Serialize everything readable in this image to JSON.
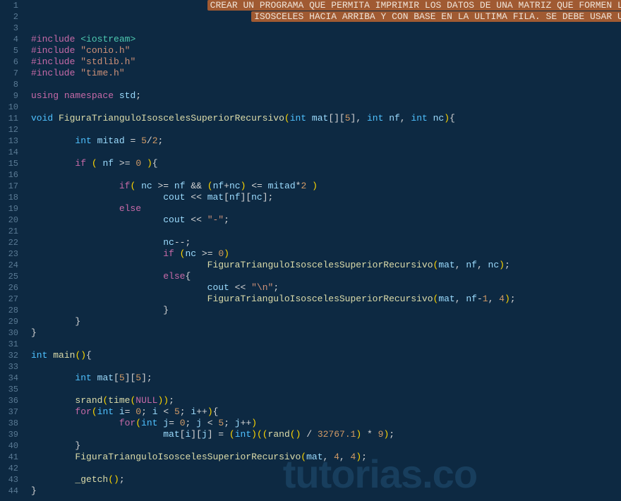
{
  "watermark": "tutorias.co",
  "gutter": {
    "start": 1,
    "end": 44
  },
  "lines": [
    {
      "indent": 8,
      "tokens": [
        {
          "cls": "comment-banner",
          "t": "CREAR UN PROGRAMA QUE PERMITA IMPRIMIR LOS DATOS DE UNA MATRIZ QUE FORMEN LA FIGURA TRIANGULO"
        }
      ],
      "ws": true
    },
    {
      "indent": 10,
      "tokens": [
        {
          "cls": "comment-banner",
          "t": "ISOSCELES HACIA ARRIBA Y CON BASE EN LA ULTIMA FILA. SE DEBE USAR UNA FUNCION RECURSIVA"
        }
      ],
      "ws": true
    },
    {
      "blank": true
    },
    {
      "tokens": [
        {
          "cls": "pp",
          "t": "#include"
        },
        {
          "cls": "plain",
          "t": " "
        },
        {
          "cls": "inc",
          "t": "<iostream>"
        }
      ]
    },
    {
      "tokens": [
        {
          "cls": "pp",
          "t": "#include"
        },
        {
          "cls": "plain",
          "t": " "
        },
        {
          "cls": "str",
          "t": "\"conio.h\""
        }
      ]
    },
    {
      "tokens": [
        {
          "cls": "pp",
          "t": "#include"
        },
        {
          "cls": "plain",
          "t": " "
        },
        {
          "cls": "str",
          "t": "\"stdlib.h\""
        }
      ]
    },
    {
      "tokens": [
        {
          "cls": "pp",
          "t": "#include"
        },
        {
          "cls": "plain",
          "t": " "
        },
        {
          "cls": "str",
          "t": "\"time.h\""
        }
      ]
    },
    {
      "blank": true
    },
    {
      "tokens": [
        {
          "cls": "key",
          "t": "using"
        },
        {
          "cls": "plain",
          "t": " "
        },
        {
          "cls": "key",
          "t": "namespace"
        },
        {
          "cls": "plain",
          "t": " "
        },
        {
          "cls": "ident",
          "t": "std"
        },
        {
          "cls": "punc",
          "t": ";"
        }
      ]
    },
    {
      "blank": true
    },
    {
      "tokens": [
        {
          "cls": "type",
          "t": "void"
        },
        {
          "cls": "plain",
          "t": " "
        },
        {
          "cls": "func",
          "t": "FiguraTrianguloIsoscelesSuperiorRecursivo"
        },
        {
          "cls": "paren",
          "t": "("
        },
        {
          "cls": "type",
          "t": "int"
        },
        {
          "cls": "plain",
          "t": " "
        },
        {
          "cls": "ident",
          "t": "mat"
        },
        {
          "cls": "punc",
          "t": "[]["
        },
        {
          "cls": "num",
          "t": "5"
        },
        {
          "cls": "punc",
          "t": "]"
        },
        {
          "cls": "punc",
          "t": ", "
        },
        {
          "cls": "type",
          "t": "int"
        },
        {
          "cls": "plain",
          "t": " "
        },
        {
          "cls": "ident",
          "t": "nf"
        },
        {
          "cls": "punc",
          "t": ", "
        },
        {
          "cls": "type",
          "t": "int"
        },
        {
          "cls": "plain",
          "t": " "
        },
        {
          "cls": "ident",
          "t": "nc"
        },
        {
          "cls": "paren",
          "t": ")"
        },
        {
          "cls": "punc",
          "t": "{"
        }
      ]
    },
    {
      "blank": true
    },
    {
      "indent": 2,
      "tokens": [
        {
          "cls": "type",
          "t": "int"
        },
        {
          "cls": "plain",
          "t": " "
        },
        {
          "cls": "ident",
          "t": "mitad"
        },
        {
          "cls": "plain",
          "t": " "
        },
        {
          "cls": "op",
          "t": "="
        },
        {
          "cls": "plain",
          "t": " "
        },
        {
          "cls": "num",
          "t": "5"
        },
        {
          "cls": "op",
          "t": "/"
        },
        {
          "cls": "num",
          "t": "2"
        },
        {
          "cls": "punc",
          "t": ";"
        }
      ]
    },
    {
      "blank": true
    },
    {
      "indent": 2,
      "tokens": [
        {
          "cls": "key",
          "t": "if"
        },
        {
          "cls": "plain",
          "t": " "
        },
        {
          "cls": "paren",
          "t": "("
        },
        {
          "cls": "plain",
          "t": " "
        },
        {
          "cls": "ident",
          "t": "nf"
        },
        {
          "cls": "plain",
          "t": " "
        },
        {
          "cls": "op",
          "t": ">="
        },
        {
          "cls": "plain",
          "t": " "
        },
        {
          "cls": "num",
          "t": "0"
        },
        {
          "cls": "plain",
          "t": " "
        },
        {
          "cls": "paren",
          "t": ")"
        },
        {
          "cls": "punc",
          "t": "{"
        }
      ]
    },
    {
      "blank": true
    },
    {
      "indent": 4,
      "tokens": [
        {
          "cls": "key",
          "t": "if"
        },
        {
          "cls": "paren",
          "t": "("
        },
        {
          "cls": "plain",
          "t": " "
        },
        {
          "cls": "ident",
          "t": "nc"
        },
        {
          "cls": "plain",
          "t": " "
        },
        {
          "cls": "op",
          "t": ">="
        },
        {
          "cls": "plain",
          "t": " "
        },
        {
          "cls": "ident",
          "t": "nf"
        },
        {
          "cls": "plain",
          "t": " "
        },
        {
          "cls": "op",
          "t": "&&"
        },
        {
          "cls": "plain",
          "t": " "
        },
        {
          "cls": "paren",
          "t": "("
        },
        {
          "cls": "ident",
          "t": "nf"
        },
        {
          "cls": "op",
          "t": "+"
        },
        {
          "cls": "ident",
          "t": "nc"
        },
        {
          "cls": "paren",
          "t": ")"
        },
        {
          "cls": "plain",
          "t": " "
        },
        {
          "cls": "op",
          "t": "<="
        },
        {
          "cls": "plain",
          "t": " "
        },
        {
          "cls": "ident",
          "t": "mitad"
        },
        {
          "cls": "op",
          "t": "*"
        },
        {
          "cls": "num",
          "t": "2"
        },
        {
          "cls": "plain",
          "t": " "
        },
        {
          "cls": "paren",
          "t": ")"
        }
      ]
    },
    {
      "indent": 6,
      "tokens": [
        {
          "cls": "ident",
          "t": "cout"
        },
        {
          "cls": "plain",
          "t": " "
        },
        {
          "cls": "op",
          "t": "<<"
        },
        {
          "cls": "plain",
          "t": " "
        },
        {
          "cls": "ident",
          "t": "mat"
        },
        {
          "cls": "punc",
          "t": "["
        },
        {
          "cls": "ident",
          "t": "nf"
        },
        {
          "cls": "punc",
          "t": "]["
        },
        {
          "cls": "ident",
          "t": "nc"
        },
        {
          "cls": "punc",
          "t": "];"
        }
      ]
    },
    {
      "indent": 4,
      "tokens": [
        {
          "cls": "key",
          "t": "else"
        }
      ]
    },
    {
      "indent": 6,
      "tokens": [
        {
          "cls": "ident",
          "t": "cout"
        },
        {
          "cls": "plain",
          "t": " "
        },
        {
          "cls": "op",
          "t": "<<"
        },
        {
          "cls": "plain",
          "t": " "
        },
        {
          "cls": "str",
          "t": "\"-\""
        },
        {
          "cls": "punc",
          "t": ";"
        }
      ]
    },
    {
      "blank": true
    },
    {
      "indent": 6,
      "tokens": [
        {
          "cls": "ident",
          "t": "nc"
        },
        {
          "cls": "op",
          "t": "--"
        },
        {
          "cls": "punc",
          "t": ";"
        }
      ]
    },
    {
      "indent": 6,
      "tokens": [
        {
          "cls": "key",
          "t": "if"
        },
        {
          "cls": "plain",
          "t": " "
        },
        {
          "cls": "paren",
          "t": "("
        },
        {
          "cls": "ident",
          "t": "nc"
        },
        {
          "cls": "plain",
          "t": " "
        },
        {
          "cls": "op",
          "t": ">="
        },
        {
          "cls": "plain",
          "t": " "
        },
        {
          "cls": "num",
          "t": "0"
        },
        {
          "cls": "paren",
          "t": ")"
        }
      ]
    },
    {
      "indent": 8,
      "tokens": [
        {
          "cls": "func",
          "t": "FiguraTrianguloIsoscelesSuperiorRecursivo"
        },
        {
          "cls": "paren",
          "t": "("
        },
        {
          "cls": "ident",
          "t": "mat"
        },
        {
          "cls": "punc",
          "t": ", "
        },
        {
          "cls": "ident",
          "t": "nf"
        },
        {
          "cls": "punc",
          "t": ", "
        },
        {
          "cls": "ident",
          "t": "nc"
        },
        {
          "cls": "paren",
          "t": ")"
        },
        {
          "cls": "punc",
          "t": ";"
        }
      ]
    },
    {
      "indent": 6,
      "tokens": [
        {
          "cls": "key",
          "t": "else"
        },
        {
          "cls": "punc",
          "t": "{"
        }
      ]
    },
    {
      "indent": 8,
      "tokens": [
        {
          "cls": "ident",
          "t": "cout"
        },
        {
          "cls": "plain",
          "t": " "
        },
        {
          "cls": "op",
          "t": "<<"
        },
        {
          "cls": "plain",
          "t": " "
        },
        {
          "cls": "str",
          "t": "\"\\n\""
        },
        {
          "cls": "punc",
          "t": ";"
        }
      ]
    },
    {
      "indent": 8,
      "tokens": [
        {
          "cls": "func",
          "t": "FiguraTrianguloIsoscelesSuperiorRecursivo"
        },
        {
          "cls": "paren",
          "t": "("
        },
        {
          "cls": "ident",
          "t": "mat"
        },
        {
          "cls": "punc",
          "t": ", "
        },
        {
          "cls": "ident",
          "t": "nf"
        },
        {
          "cls": "op",
          "t": "-"
        },
        {
          "cls": "num",
          "t": "1"
        },
        {
          "cls": "punc",
          "t": ", "
        },
        {
          "cls": "num",
          "t": "4"
        },
        {
          "cls": "paren",
          "t": ")"
        },
        {
          "cls": "punc",
          "t": ";"
        }
      ]
    },
    {
      "indent": 6,
      "tokens": [
        {
          "cls": "punc",
          "t": "}"
        }
      ]
    },
    {
      "indent": 2,
      "tokens": [
        {
          "cls": "punc",
          "t": "}"
        }
      ]
    },
    {
      "tokens": [
        {
          "cls": "punc",
          "t": "}"
        }
      ]
    },
    {
      "blank": true
    },
    {
      "tokens": [
        {
          "cls": "type",
          "t": "int"
        },
        {
          "cls": "plain",
          "t": " "
        },
        {
          "cls": "func",
          "t": "main"
        },
        {
          "cls": "paren",
          "t": "()"
        },
        {
          "cls": "punc",
          "t": "{"
        }
      ]
    },
    {
      "blank": true
    },
    {
      "indent": 2,
      "tokens": [
        {
          "cls": "type",
          "t": "int"
        },
        {
          "cls": "plain",
          "t": " "
        },
        {
          "cls": "ident",
          "t": "mat"
        },
        {
          "cls": "punc",
          "t": "["
        },
        {
          "cls": "num",
          "t": "5"
        },
        {
          "cls": "punc",
          "t": "]["
        },
        {
          "cls": "num",
          "t": "5"
        },
        {
          "cls": "punc",
          "t": "];"
        }
      ]
    },
    {
      "blank": true
    },
    {
      "indent": 2,
      "tokens": [
        {
          "cls": "func",
          "t": "srand"
        },
        {
          "cls": "paren",
          "t": "("
        },
        {
          "cls": "func",
          "t": "time"
        },
        {
          "cls": "paren",
          "t": "("
        },
        {
          "cls": "key",
          "t": "NULL"
        },
        {
          "cls": "paren",
          "t": "))"
        },
        {
          "cls": "punc",
          "t": ";"
        }
      ]
    },
    {
      "indent": 2,
      "tokens": [
        {
          "cls": "key",
          "t": "for"
        },
        {
          "cls": "paren",
          "t": "("
        },
        {
          "cls": "type",
          "t": "int"
        },
        {
          "cls": "plain",
          "t": " "
        },
        {
          "cls": "ident",
          "t": "i"
        },
        {
          "cls": "op",
          "t": "="
        },
        {
          "cls": "plain",
          "t": " "
        },
        {
          "cls": "num",
          "t": "0"
        },
        {
          "cls": "punc",
          "t": "; "
        },
        {
          "cls": "ident",
          "t": "i"
        },
        {
          "cls": "plain",
          "t": " "
        },
        {
          "cls": "op",
          "t": "<"
        },
        {
          "cls": "plain",
          "t": " "
        },
        {
          "cls": "num",
          "t": "5"
        },
        {
          "cls": "punc",
          "t": "; "
        },
        {
          "cls": "ident",
          "t": "i"
        },
        {
          "cls": "op",
          "t": "++"
        },
        {
          "cls": "paren",
          "t": ")"
        },
        {
          "cls": "punc",
          "t": "{"
        }
      ]
    },
    {
      "indent": 4,
      "tokens": [
        {
          "cls": "key",
          "t": "for"
        },
        {
          "cls": "paren",
          "t": "("
        },
        {
          "cls": "type",
          "t": "int"
        },
        {
          "cls": "plain",
          "t": " "
        },
        {
          "cls": "ident",
          "t": "j"
        },
        {
          "cls": "op",
          "t": "="
        },
        {
          "cls": "plain",
          "t": " "
        },
        {
          "cls": "num",
          "t": "0"
        },
        {
          "cls": "punc",
          "t": "; "
        },
        {
          "cls": "ident",
          "t": "j"
        },
        {
          "cls": "plain",
          "t": " "
        },
        {
          "cls": "op",
          "t": "<"
        },
        {
          "cls": "plain",
          "t": " "
        },
        {
          "cls": "num",
          "t": "5"
        },
        {
          "cls": "punc",
          "t": "; "
        },
        {
          "cls": "ident",
          "t": "j"
        },
        {
          "cls": "op",
          "t": "++"
        },
        {
          "cls": "paren",
          "t": ")"
        }
      ]
    },
    {
      "indent": 6,
      "tokens": [
        {
          "cls": "ident",
          "t": "mat"
        },
        {
          "cls": "punc",
          "t": "["
        },
        {
          "cls": "ident",
          "t": "i"
        },
        {
          "cls": "punc",
          "t": "]["
        },
        {
          "cls": "ident",
          "t": "j"
        },
        {
          "cls": "punc",
          "t": "] "
        },
        {
          "cls": "op",
          "t": "="
        },
        {
          "cls": "plain",
          "t": " "
        },
        {
          "cls": "paren",
          "t": "("
        },
        {
          "cls": "type",
          "t": "int"
        },
        {
          "cls": "paren",
          "t": ")(("
        },
        {
          "cls": "func",
          "t": "rand"
        },
        {
          "cls": "paren",
          "t": "()"
        },
        {
          "cls": "plain",
          "t": " "
        },
        {
          "cls": "op",
          "t": "/"
        },
        {
          "cls": "plain",
          "t": " "
        },
        {
          "cls": "num",
          "t": "32767.1"
        },
        {
          "cls": "paren",
          "t": ")"
        },
        {
          "cls": "plain",
          "t": " "
        },
        {
          "cls": "op",
          "t": "*"
        },
        {
          "cls": "plain",
          "t": " "
        },
        {
          "cls": "num",
          "t": "9"
        },
        {
          "cls": "paren",
          "t": ")"
        },
        {
          "cls": "punc",
          "t": ";"
        }
      ]
    },
    {
      "indent": 2,
      "tokens": [
        {
          "cls": "punc",
          "t": "}"
        }
      ]
    },
    {
      "indent": 2,
      "tokens": [
        {
          "cls": "func",
          "t": "FiguraTrianguloIsoscelesSuperiorRecursivo"
        },
        {
          "cls": "paren",
          "t": "("
        },
        {
          "cls": "ident",
          "t": "mat"
        },
        {
          "cls": "punc",
          "t": ", "
        },
        {
          "cls": "num",
          "t": "4"
        },
        {
          "cls": "punc",
          "t": ", "
        },
        {
          "cls": "num",
          "t": "4"
        },
        {
          "cls": "paren",
          "t": ")"
        },
        {
          "cls": "punc",
          "t": ";"
        }
      ]
    },
    {
      "blank": true
    },
    {
      "indent": 2,
      "tokens": [
        {
          "cls": "func",
          "t": "_getch"
        },
        {
          "cls": "paren",
          "t": "()"
        },
        {
          "cls": "punc",
          "t": ";"
        }
      ]
    },
    {
      "tokens": [
        {
          "cls": "punc",
          "t": "}"
        }
      ]
    }
  ]
}
